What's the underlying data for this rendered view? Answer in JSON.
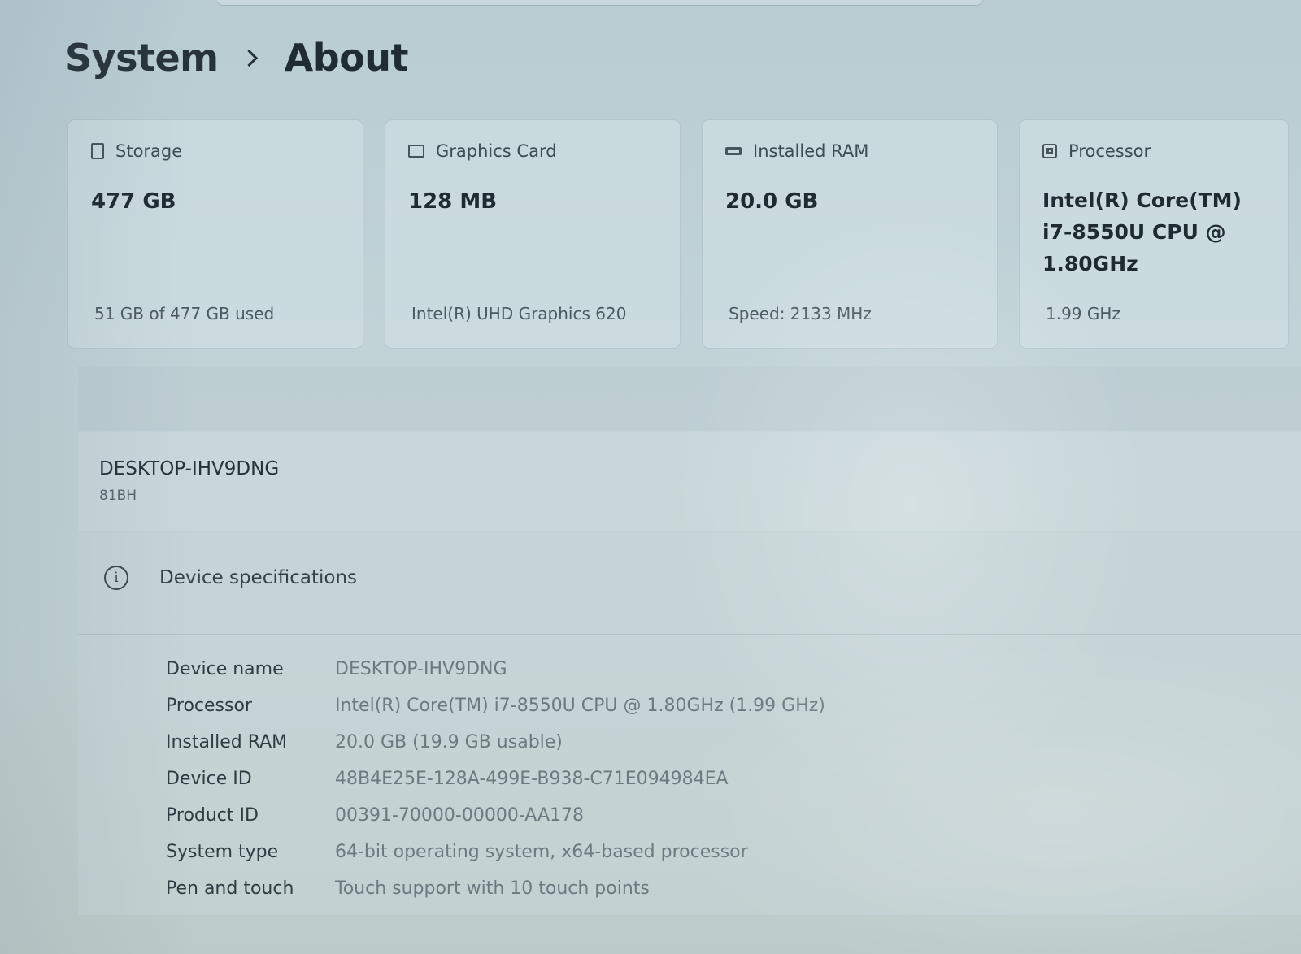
{
  "breadcrumb": {
    "parent": "System",
    "current": "About"
  },
  "cards": [
    {
      "icon": "storage-icon",
      "label": "Storage",
      "value": "477 GB",
      "sub": "51 GB of 477 GB used"
    },
    {
      "icon": "graphics-card-icon",
      "label": "Graphics Card",
      "value": "128 MB",
      "sub": "Intel(R) UHD Graphics 620"
    },
    {
      "icon": "ram-icon",
      "label": "Installed RAM",
      "value": "20.0 GB",
      "sub": "Speed: 2133 MHz"
    },
    {
      "icon": "processor-icon",
      "label": "Processor",
      "value": "Intel(R) Core(TM) i7-8550U CPU @ 1.80GHz",
      "sub": "1.99 GHz"
    }
  ],
  "device": {
    "name": "DESKTOP-IHV9DNG",
    "model": "81BH"
  },
  "specs": {
    "title": "Device specifications",
    "rows": [
      {
        "label": "Device name",
        "value": "DESKTOP-IHV9DNG"
      },
      {
        "label": "Processor",
        "value": "Intel(R) Core(TM) i7-8550U CPU @ 1.80GHz (1.99 GHz)"
      },
      {
        "label": "Installed RAM",
        "value": "20.0 GB (19.9 GB usable)"
      },
      {
        "label": "Device ID",
        "value": "48B4E25E-128A-499E-B938-C71E094984EA"
      },
      {
        "label": "Product ID",
        "value": "00391-70000-00000-AA178"
      },
      {
        "label": "System type",
        "value": "64-bit operating system, x64-based processor"
      },
      {
        "label": "Pen and touch",
        "value": "Touch support with 10 touch points"
      }
    ]
  }
}
